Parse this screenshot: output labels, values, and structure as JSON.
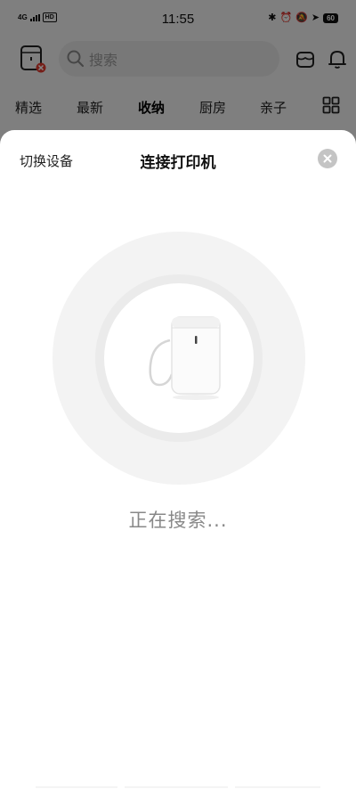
{
  "status_bar": {
    "network": "4G",
    "hd": "HD",
    "time": "11:55",
    "battery": "60",
    "icons": [
      "bluetooth-icon",
      "alarm-icon",
      "mute-icon",
      "location-icon"
    ]
  },
  "header": {
    "search_placeholder": "搜索"
  },
  "tabs": [
    "精选",
    "最新",
    "收纳",
    "厨房",
    "亲子"
  ],
  "active_tab": "收纳",
  "sheet": {
    "switch_device": "切换设备",
    "title": "连接打印机",
    "status": "正在搜索..."
  },
  "colors": {
    "dim_overlay": "#000000",
    "badge_red": "#e03b2f",
    "search_text": "#888888"
  }
}
